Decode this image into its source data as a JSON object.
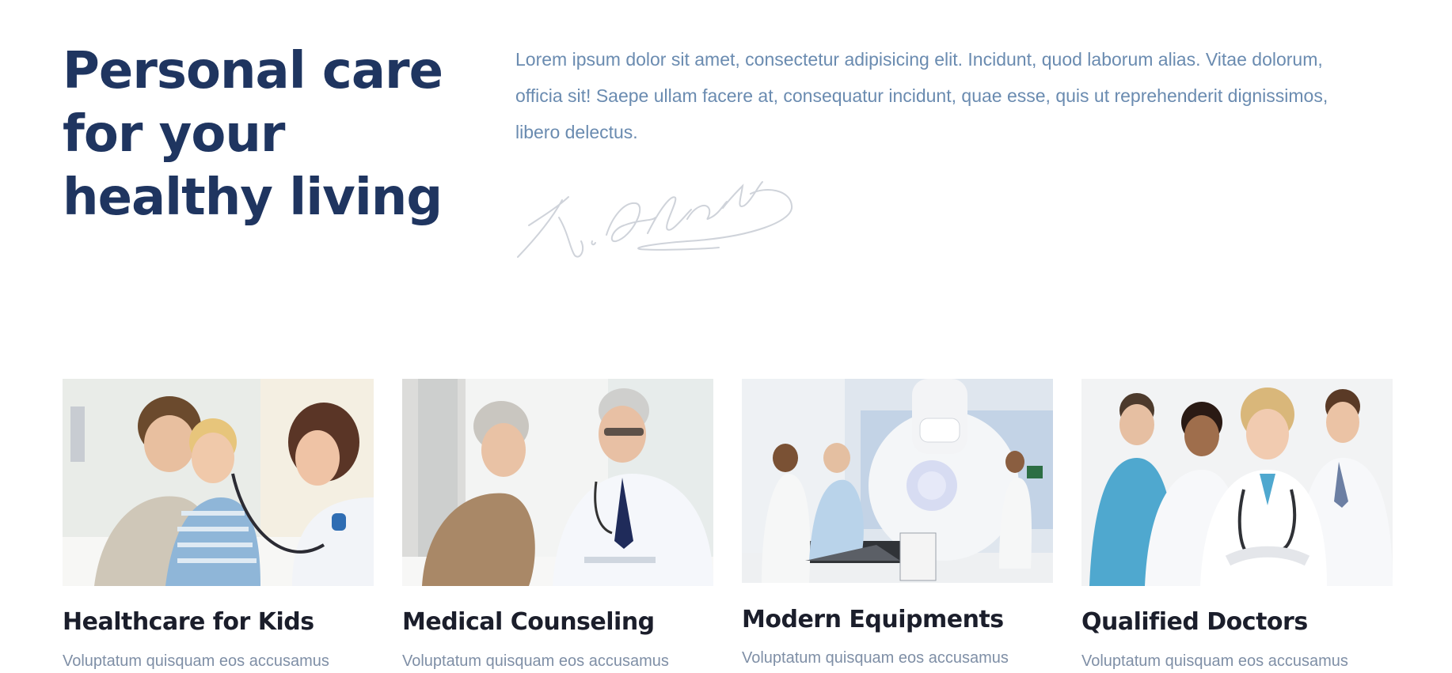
{
  "hero": {
    "title": "Personal care for your healthy living",
    "intro": "Lorem ipsum dolor sit amet, consectetur adipisicing elit. Incidunt, quod laborum alias. Vitae dolorum, officia sit! Saepe ullam facere at, consequatur incidunt, quae esse, quis ut reprehenderit dignissimos, libero delectus.",
    "signature_text": "K. Atatürk"
  },
  "colors": {
    "heading": "#1f3560",
    "body_text": "#6a8bb0",
    "card_title": "#1b1e2b"
  },
  "cards": [
    {
      "title": "Healthcare for Kids",
      "text": "Voluptatum quisquam eos accusamus"
    },
    {
      "title": "Medical Counseling",
      "text": "Voluptatum quisquam eos accusamus"
    },
    {
      "title": "Modern Equipments",
      "text": "Voluptatum quisquam eos accusamus"
    },
    {
      "title": "Qualified Doctors",
      "text": "Voluptatum quisquam eos accusamus"
    }
  ]
}
